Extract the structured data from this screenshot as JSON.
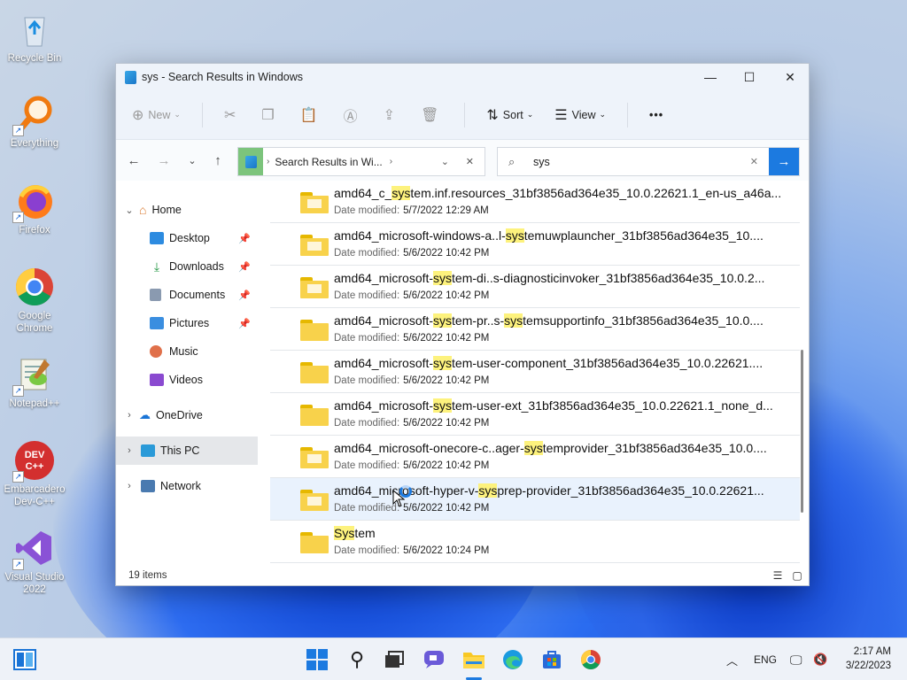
{
  "desktop": {
    "icons": [
      {
        "label": "Recycle Bin",
        "icon": "recycle-bin-icon"
      },
      {
        "label": "Everything",
        "icon": "everything-search-icon"
      },
      {
        "label": "Firefox",
        "icon": "firefox-icon"
      },
      {
        "label": "Google Chrome",
        "icon": "chrome-icon"
      },
      {
        "label": "Notepad++",
        "icon": "notepad-plus-plus-icon"
      },
      {
        "label": "Embarcadero Dev-C++",
        "icon": "dev-cpp-icon"
      },
      {
        "label": "Visual Studio 2022",
        "icon": "visual-studio-icon"
      }
    ]
  },
  "window": {
    "title": "sys - Search Results in Windows",
    "controls": {
      "minimize": "—",
      "maximize": "☐",
      "close": "✕"
    }
  },
  "toolbar": {
    "new_label": "New",
    "sort_label": "Sort",
    "view_label": "View",
    "more_label": "•••"
  },
  "navigation": {
    "address_crumb": "Search Results in Wi...",
    "search_value": "sys"
  },
  "sidebar": {
    "items": [
      {
        "label": "Home",
        "icon": "home-icon",
        "expanded": true
      },
      {
        "label": "Desktop",
        "icon": "desktop-icon",
        "pinned": true
      },
      {
        "label": "Downloads",
        "icon": "download-icon",
        "pinned": true
      },
      {
        "label": "Documents",
        "icon": "documents-icon",
        "pinned": true
      },
      {
        "label": "Pictures",
        "icon": "pictures-icon",
        "pinned": true
      },
      {
        "label": "Music",
        "icon": "music-icon"
      },
      {
        "label": "Videos",
        "icon": "videos-icon"
      },
      {
        "label": "OneDrive",
        "icon": "onedrive-icon"
      },
      {
        "label": "This PC",
        "icon": "this-pc-icon",
        "selected": true
      },
      {
        "label": "Network",
        "icon": "network-icon"
      }
    ]
  },
  "results": {
    "date_label": "Date modified:",
    "rows": [
      {
        "pre": "amd64_c_",
        "hl": "sys",
        "post": "tem.inf.resources_31bf3856ad364e35_10.0.22621.1_en-us_a46a...",
        "hl2pre": "",
        "hl2": "",
        "hl2post": "",
        "date": "5/7/2022 12:29 AM"
      },
      {
        "pre": "amd64_microsoft-windows-a..l-",
        "hl": "sys",
        "post": "temuwplauncher_31bf3856ad364e35_10....",
        "hl2pre": "",
        "hl2": "",
        "hl2post": "",
        "date": "5/6/2022 10:42 PM"
      },
      {
        "pre": "amd64_microsoft-",
        "hl": "sys",
        "post": "tem-di..s-diagnosticinvoker_31bf3856ad364e35_10.0.2...",
        "hl2pre": "",
        "hl2": "",
        "hl2post": "",
        "date": "5/6/2022 10:42 PM"
      },
      {
        "pre": "amd64_microsoft-",
        "hl": "sys",
        "post": "tem-pr..s-",
        "hl2pre": "",
        "hl2": "sys",
        "hl2post": "temsupportinfo_31bf3856ad364e35_10.0....",
        "date": "5/6/2022 10:42 PM"
      },
      {
        "pre": "amd64_microsoft-",
        "hl": "sys",
        "post": "tem-user-component_31bf3856ad364e35_10.0.22621....",
        "hl2pre": "",
        "hl2": "",
        "hl2post": "",
        "date": "5/6/2022 10:42 PM"
      },
      {
        "pre": "amd64_microsoft-",
        "hl": "sys",
        "post": "tem-user-ext_31bf3856ad364e35_10.0.22621.1_none_d...",
        "hl2pre": "",
        "hl2": "",
        "hl2post": "",
        "date": "5/6/2022 10:42 PM"
      },
      {
        "pre": "amd64_microsoft-onecore-c..ager-",
        "hl": "sys",
        "post": "temprovider_31bf3856ad364e35_10.0....",
        "hl2pre": "",
        "hl2": "",
        "hl2post": "",
        "date": "5/6/2022 10:42 PM"
      },
      {
        "pre": "amd64_microsoft-hyper-v-",
        "hl": "sys",
        "post": "prep-provider_31bf3856ad364e35_10.0.22621...",
        "hl2pre": "",
        "hl2": "",
        "hl2post": "",
        "date": "5/6/2022 10:42 PM"
      },
      {
        "pre": "",
        "hl": "Sys",
        "post": "tem",
        "hl2pre": "",
        "hl2": "",
        "hl2post": "",
        "date": "5/6/2022 10:24 PM"
      }
    ]
  },
  "status": {
    "count": "19 items"
  },
  "taskbar": {
    "lang": "ENG",
    "time": "2:17 AM",
    "date": "3/22/2023"
  },
  "colors": {
    "accent": "#1c7ae0",
    "highlight": "#fdf27d",
    "folder": "#f8d24b"
  }
}
